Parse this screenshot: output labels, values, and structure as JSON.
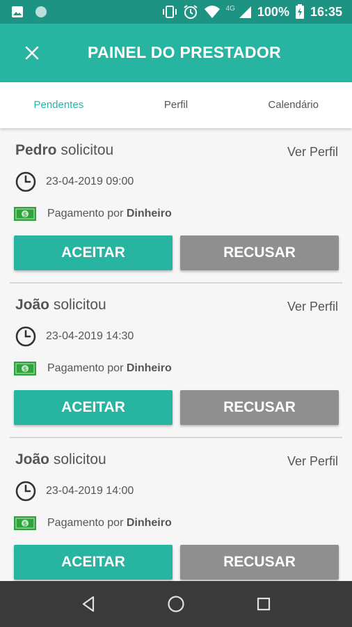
{
  "status_bar": {
    "network": "4G",
    "battery": "100%",
    "time": "16:35"
  },
  "app_bar": {
    "title": "PAINEL DO PRESTADOR"
  },
  "tabs": [
    {
      "label": "Pendentes",
      "active": true
    },
    {
      "label": "Perfil",
      "active": false
    },
    {
      "label": "Calendário",
      "active": false
    }
  ],
  "requests": [
    {
      "name": "Pedro",
      "action": " solicitou",
      "profile_link": "Ver Perfil",
      "datetime": "23-04-2019 09:00",
      "payment_prefix": "Pagamento por ",
      "payment_method": "Dinheiro",
      "accept_label": "ACEITAR",
      "reject_label": "RECUSAR"
    },
    {
      "name": "João",
      "action": " solicitou",
      "profile_link": "Ver Perfil",
      "datetime": "23-04-2019 14:30",
      "payment_prefix": "Pagamento por ",
      "payment_method": "Dinheiro",
      "accept_label": "ACEITAR",
      "reject_label": "RECUSAR"
    },
    {
      "name": "João",
      "action": " solicitou",
      "profile_link": "Ver Perfil",
      "datetime": "23-04-2019 14:00",
      "payment_prefix": "Pagamento por ",
      "payment_method": "Dinheiro",
      "accept_label": "ACEITAR",
      "reject_label": "RECUSAR"
    }
  ],
  "colors": {
    "primary": "#27b4a1",
    "primary_dark": "#1d9384",
    "reject": "#8f8f8f",
    "money_green": "#2fa43c"
  }
}
